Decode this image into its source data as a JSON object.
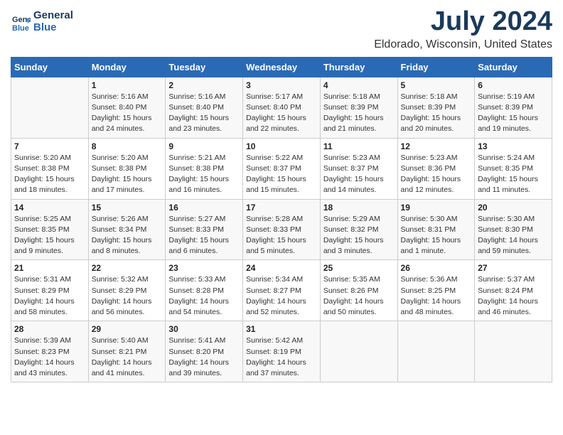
{
  "header": {
    "logo_line1": "General",
    "logo_line2": "Blue",
    "title": "July 2024",
    "subtitle": "Eldorado, Wisconsin, United States"
  },
  "days_of_week": [
    "Sunday",
    "Monday",
    "Tuesday",
    "Wednesday",
    "Thursday",
    "Friday",
    "Saturday"
  ],
  "weeks": [
    [
      {
        "num": "",
        "info": ""
      },
      {
        "num": "1",
        "info": "Sunrise: 5:16 AM\nSunset: 8:40 PM\nDaylight: 15 hours\nand 24 minutes."
      },
      {
        "num": "2",
        "info": "Sunrise: 5:16 AM\nSunset: 8:40 PM\nDaylight: 15 hours\nand 23 minutes."
      },
      {
        "num": "3",
        "info": "Sunrise: 5:17 AM\nSunset: 8:40 PM\nDaylight: 15 hours\nand 22 minutes."
      },
      {
        "num": "4",
        "info": "Sunrise: 5:18 AM\nSunset: 8:39 PM\nDaylight: 15 hours\nand 21 minutes."
      },
      {
        "num": "5",
        "info": "Sunrise: 5:18 AM\nSunset: 8:39 PM\nDaylight: 15 hours\nand 20 minutes."
      },
      {
        "num": "6",
        "info": "Sunrise: 5:19 AM\nSunset: 8:39 PM\nDaylight: 15 hours\nand 19 minutes."
      }
    ],
    [
      {
        "num": "7",
        "info": "Sunrise: 5:20 AM\nSunset: 8:38 PM\nDaylight: 15 hours\nand 18 minutes."
      },
      {
        "num": "8",
        "info": "Sunrise: 5:20 AM\nSunset: 8:38 PM\nDaylight: 15 hours\nand 17 minutes."
      },
      {
        "num": "9",
        "info": "Sunrise: 5:21 AM\nSunset: 8:38 PM\nDaylight: 15 hours\nand 16 minutes."
      },
      {
        "num": "10",
        "info": "Sunrise: 5:22 AM\nSunset: 8:37 PM\nDaylight: 15 hours\nand 15 minutes."
      },
      {
        "num": "11",
        "info": "Sunrise: 5:23 AM\nSunset: 8:37 PM\nDaylight: 15 hours\nand 14 minutes."
      },
      {
        "num": "12",
        "info": "Sunrise: 5:23 AM\nSunset: 8:36 PM\nDaylight: 15 hours\nand 12 minutes."
      },
      {
        "num": "13",
        "info": "Sunrise: 5:24 AM\nSunset: 8:35 PM\nDaylight: 15 hours\nand 11 minutes."
      }
    ],
    [
      {
        "num": "14",
        "info": "Sunrise: 5:25 AM\nSunset: 8:35 PM\nDaylight: 15 hours\nand 9 minutes."
      },
      {
        "num": "15",
        "info": "Sunrise: 5:26 AM\nSunset: 8:34 PM\nDaylight: 15 hours\nand 8 minutes."
      },
      {
        "num": "16",
        "info": "Sunrise: 5:27 AM\nSunset: 8:33 PM\nDaylight: 15 hours\nand 6 minutes."
      },
      {
        "num": "17",
        "info": "Sunrise: 5:28 AM\nSunset: 8:33 PM\nDaylight: 15 hours\nand 5 minutes."
      },
      {
        "num": "18",
        "info": "Sunrise: 5:29 AM\nSunset: 8:32 PM\nDaylight: 15 hours\nand 3 minutes."
      },
      {
        "num": "19",
        "info": "Sunrise: 5:30 AM\nSunset: 8:31 PM\nDaylight: 15 hours\nand 1 minute."
      },
      {
        "num": "20",
        "info": "Sunrise: 5:30 AM\nSunset: 8:30 PM\nDaylight: 14 hours\nand 59 minutes."
      }
    ],
    [
      {
        "num": "21",
        "info": "Sunrise: 5:31 AM\nSunset: 8:29 PM\nDaylight: 14 hours\nand 58 minutes."
      },
      {
        "num": "22",
        "info": "Sunrise: 5:32 AM\nSunset: 8:29 PM\nDaylight: 14 hours\nand 56 minutes."
      },
      {
        "num": "23",
        "info": "Sunrise: 5:33 AM\nSunset: 8:28 PM\nDaylight: 14 hours\nand 54 minutes."
      },
      {
        "num": "24",
        "info": "Sunrise: 5:34 AM\nSunset: 8:27 PM\nDaylight: 14 hours\nand 52 minutes."
      },
      {
        "num": "25",
        "info": "Sunrise: 5:35 AM\nSunset: 8:26 PM\nDaylight: 14 hours\nand 50 minutes."
      },
      {
        "num": "26",
        "info": "Sunrise: 5:36 AM\nSunset: 8:25 PM\nDaylight: 14 hours\nand 48 minutes."
      },
      {
        "num": "27",
        "info": "Sunrise: 5:37 AM\nSunset: 8:24 PM\nDaylight: 14 hours\nand 46 minutes."
      }
    ],
    [
      {
        "num": "28",
        "info": "Sunrise: 5:39 AM\nSunset: 8:23 PM\nDaylight: 14 hours\nand 43 minutes."
      },
      {
        "num": "29",
        "info": "Sunrise: 5:40 AM\nSunset: 8:21 PM\nDaylight: 14 hours\nand 41 minutes."
      },
      {
        "num": "30",
        "info": "Sunrise: 5:41 AM\nSunset: 8:20 PM\nDaylight: 14 hours\nand 39 minutes."
      },
      {
        "num": "31",
        "info": "Sunrise: 5:42 AM\nSunset: 8:19 PM\nDaylight: 14 hours\nand 37 minutes."
      },
      {
        "num": "",
        "info": ""
      },
      {
        "num": "",
        "info": ""
      },
      {
        "num": "",
        "info": ""
      }
    ]
  ]
}
